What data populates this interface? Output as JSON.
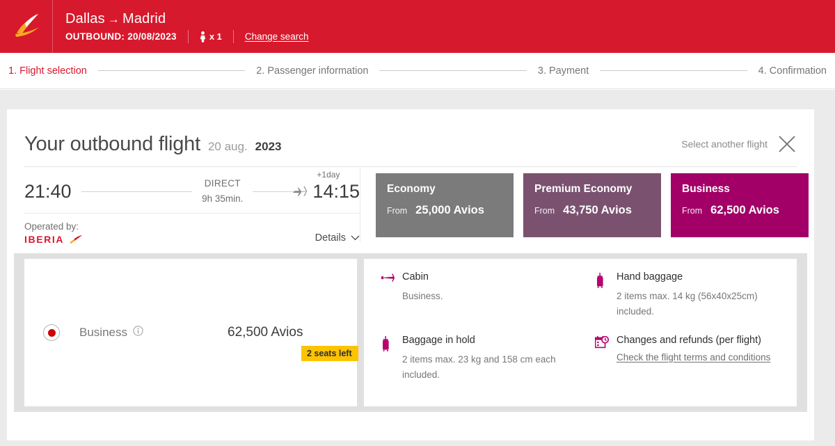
{
  "header": {
    "logo_alt": "iberia-logo",
    "origin": "Dallas",
    "arrow": "→",
    "destination": "Madrid",
    "outbound_label": "OUTBOUND: 20/08/2023",
    "passenger_count": "x 1",
    "change_search": "Change search",
    "bg_color": "#d7192d"
  },
  "steps": [
    {
      "label": "1. Flight selection",
      "active": true
    },
    {
      "label": "2. Passenger information",
      "active": false
    },
    {
      "label": "3. Payment",
      "active": false
    },
    {
      "label": "4. Confirmation",
      "active": false
    }
  ],
  "card": {
    "title": "Your outbound flight",
    "date_light": "20 aug.",
    "date_bold": "2023",
    "select_another": "Select another flight",
    "close_icon": "close-icon"
  },
  "flight": {
    "departure_time": "21:40",
    "stops": "DIRECT",
    "duration": "9h 35min.",
    "plus_day": "+1day",
    "arrival_time": "14:15",
    "operated_by_label": "Operated by:",
    "operator": "IBERIA",
    "details_label": "Details"
  },
  "fares": [
    {
      "name": "Economy",
      "from_label": "From",
      "price": "25,000 Avios",
      "color": "#7b7b7b",
      "selected": false
    },
    {
      "name": "Premium Economy",
      "from_label": "From",
      "price": "43,750 Avios",
      "color": "#7a5270",
      "selected": false
    },
    {
      "name": "Business",
      "from_label": "From",
      "price": "62,500 Avios",
      "color": "#a20067",
      "selected": true
    }
  ],
  "selection": {
    "fare_name": "Business",
    "price": "62,500 Avios",
    "seats_left": "2 seats left",
    "seats_badge_color": "#fdc300",
    "radio_color": "#cc0000"
  },
  "benefits": [
    {
      "icon": "cabin-seat-icon",
      "title": "Cabin",
      "description": "Business.",
      "link": ""
    },
    {
      "icon": "hand-baggage-icon",
      "title": "Hand baggage",
      "description": "2 items max. 14 kg (56x40x25cm) included.",
      "link": ""
    },
    {
      "icon": "baggage-in-hold-icon",
      "title": "Baggage in hold",
      "description": "2 items max. 23 kg and 158 cm each included.",
      "link": ""
    },
    {
      "icon": "calendar-clock-icon",
      "title": "Changes and refunds (per flight)",
      "description": "",
      "link": "Check the flight terms and conditions"
    }
  ]
}
